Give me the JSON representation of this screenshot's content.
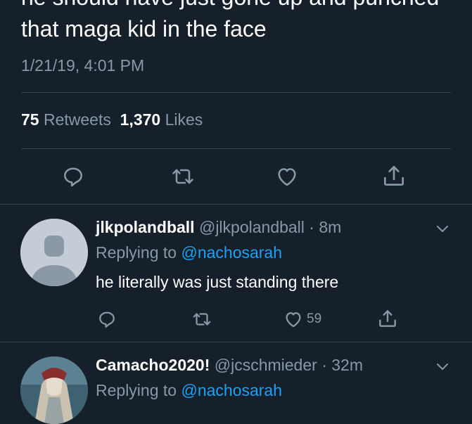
{
  "tweet": {
    "text_line_partial": "he should have just gone up and punched",
    "text_line": "that maga kid in the face",
    "timestamp": "1/21/19, 4:01 PM",
    "retweets_count": "75",
    "retweets_label": "Retweets",
    "likes_count": "1,370",
    "likes_label": "Likes"
  },
  "actions": {
    "reply_icon": "reply-icon",
    "retweet_icon": "retweet-icon",
    "like_icon": "heart-icon",
    "share_icon": "share-icon"
  },
  "replies": [
    {
      "display_name": "jlkpolandball",
      "handle_time": "@jlkpolandball · 8m",
      "replying_prefix": "Replying to",
      "replying_to": "@nachosarah",
      "text": "he literally was just standing there",
      "like_count": "59"
    },
    {
      "display_name": "Camacho2020!",
      "handle_time": "@jcschmieder · 32m",
      "replying_prefix": "Replying to",
      "replying_to": "@nachosarah"
    }
  ],
  "colors": {
    "background": "#15202b",
    "secondary_text": "#8899a6",
    "link": "#1da1f2",
    "divider": "#38444d"
  }
}
